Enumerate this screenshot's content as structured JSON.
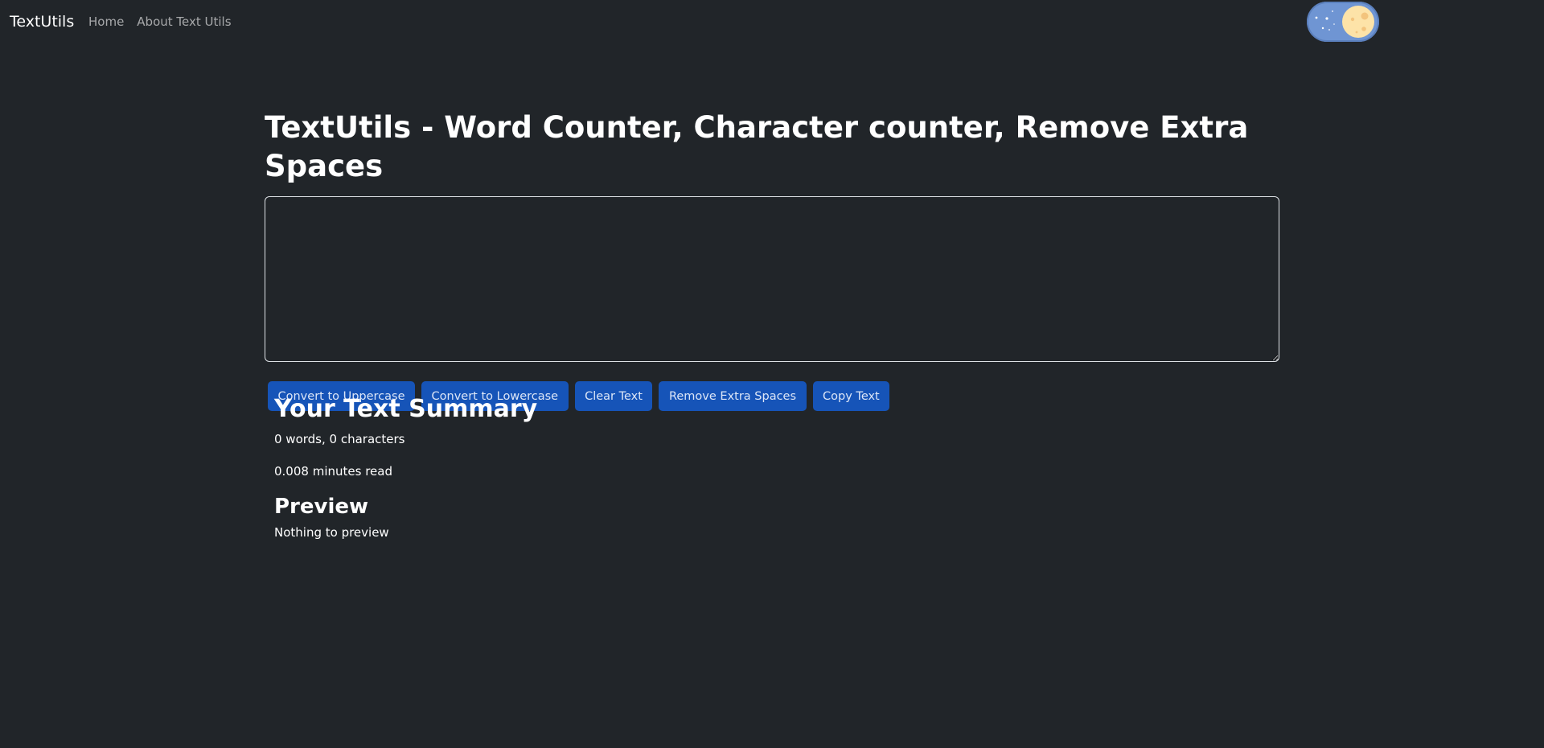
{
  "navbar": {
    "brand": "TextUtils",
    "links": [
      "Home",
      "About Text Utils"
    ]
  },
  "theme_toggle": {
    "state": "dark",
    "icon": "moon-icon",
    "colors": {
      "track": "#6f95d3",
      "moon": "#fde3a8"
    }
  },
  "main": {
    "title": "TextUtils - Word Counter, Character counter, Remove Extra Spaces",
    "textarea": {
      "value": "",
      "placeholder": ""
    },
    "buttons": [
      "Convert to Uppercase",
      "Convert to Lowercase",
      "Clear Text",
      "Remove Extra Spaces",
      "Copy Text"
    ]
  },
  "summary": {
    "heading": "Your Text Summary",
    "counts": "0 words, 0 characters",
    "read_time": "0.008 minutes read"
  },
  "preview": {
    "heading": "Preview",
    "text": "Nothing to preview"
  },
  "colors": {
    "background": "#212529",
    "button": "#1654b8"
  }
}
